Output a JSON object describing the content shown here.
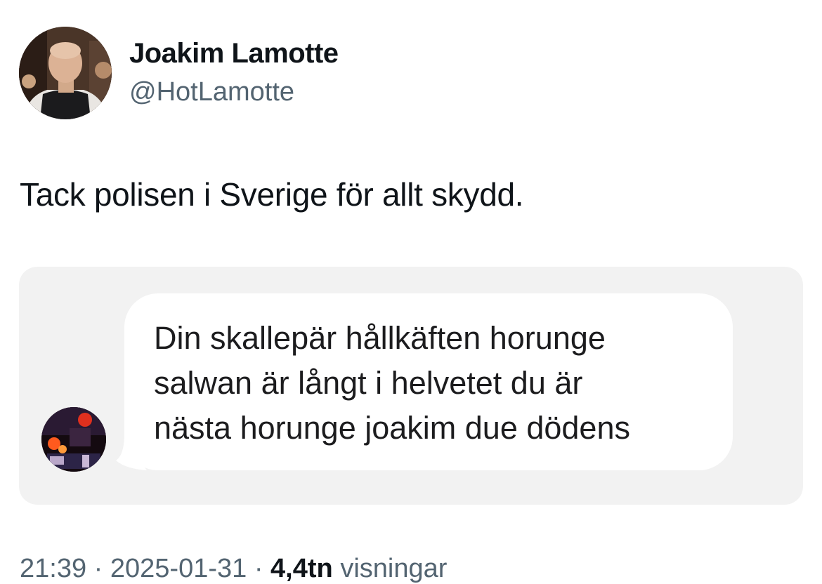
{
  "author": {
    "display_name": "Joakim Lamotte",
    "handle": "@HotLamotte"
  },
  "tweet": {
    "text": "Tack polisen i Sverige för allt skydd."
  },
  "attached_screenshot": {
    "message_lines": [
      "Din skallepär hållkäften horunge",
      "salwan är långt i helvetet du är",
      "nästa horunge joakim due dödens"
    ]
  },
  "meta": {
    "time": "21:39",
    "separator": "·",
    "date": "2025-01-31",
    "views_count": "4,4tn",
    "views_label": "visningar"
  },
  "colors": {
    "text_primary": "#0f1419",
    "text_secondary": "#536471",
    "media_background": "#f2f2f2",
    "bubble_background": "#ffffff"
  }
}
